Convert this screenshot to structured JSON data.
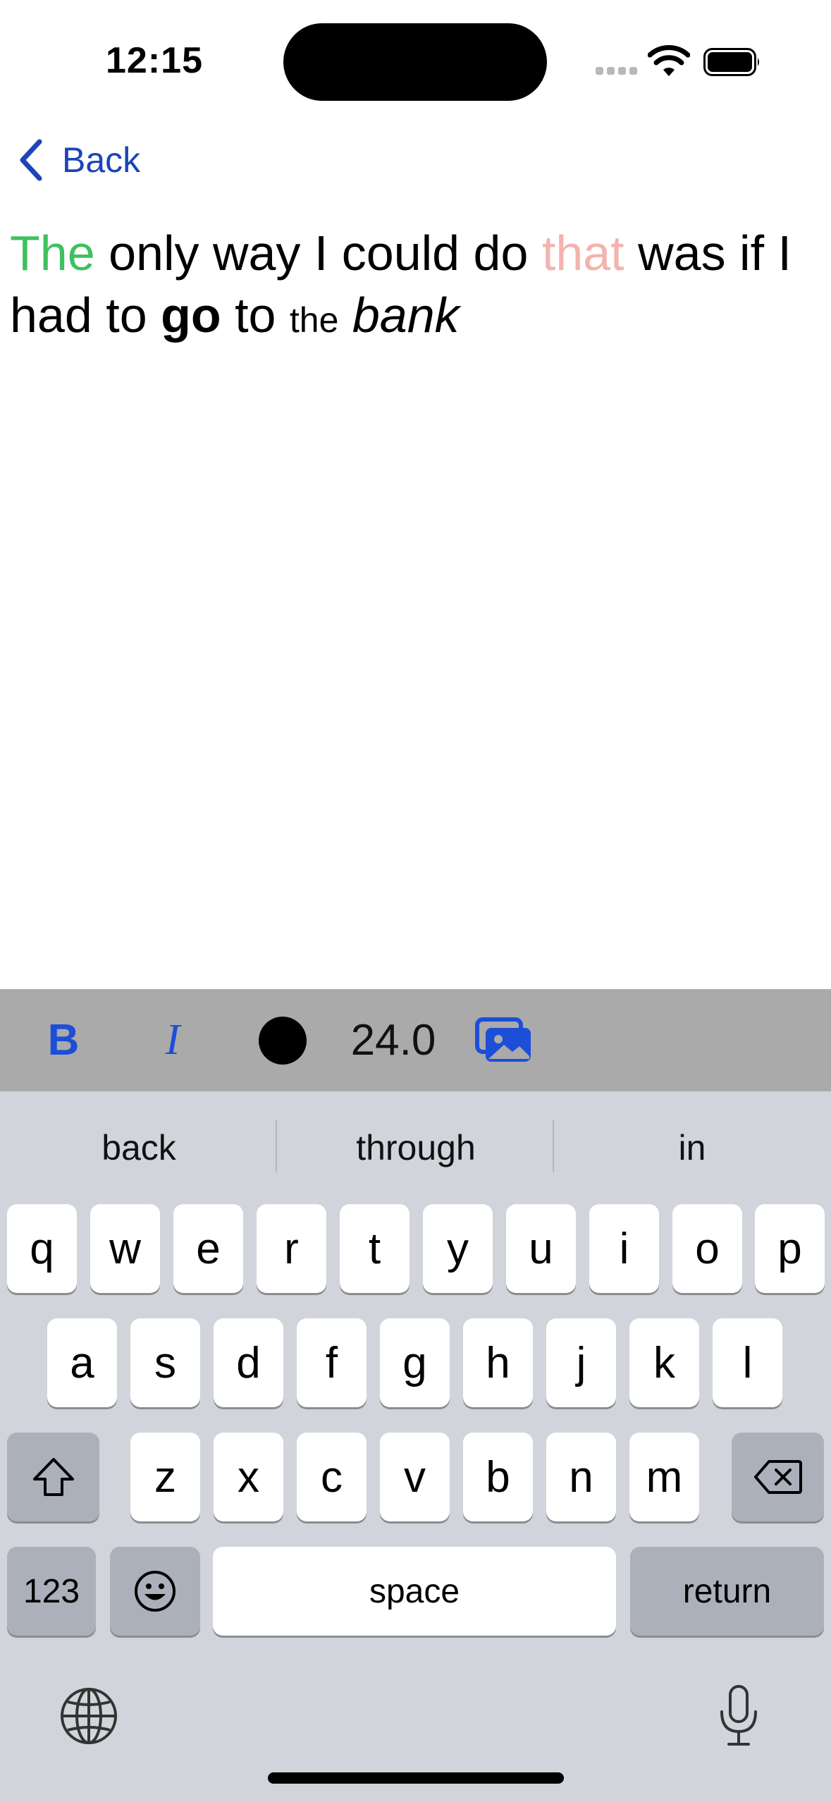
{
  "status_bar": {
    "time": "12:15"
  },
  "nav": {
    "back_label": "Back"
  },
  "editor": {
    "words": [
      {
        "text": "The",
        "style": "green",
        "color": "#3ec15e"
      },
      {
        "text": "only way I could do",
        "style": "normal"
      },
      {
        "text": "that",
        "style": "pink",
        "color": "#f3b3ae"
      },
      {
        "text": "was if I had to",
        "style": "normal"
      },
      {
        "text": "go",
        "style": "bold"
      },
      {
        "text": "to",
        "style": "normal"
      },
      {
        "text": "the",
        "style": "small"
      },
      {
        "text": "bank",
        "style": "italic"
      }
    ]
  },
  "toolbar": {
    "bold_label": "B",
    "italic_label": "I",
    "text_color": "#000000",
    "font_size": "24.0",
    "photo_icon": "photo-icon"
  },
  "keyboard": {
    "suggestions": [
      "back",
      "through",
      "in"
    ],
    "row1": [
      "q",
      "w",
      "e",
      "r",
      "t",
      "y",
      "u",
      "i",
      "o",
      "p"
    ],
    "row2": [
      "a",
      "s",
      "d",
      "f",
      "g",
      "h",
      "j",
      "k",
      "l"
    ],
    "row3": [
      "z",
      "x",
      "c",
      "v",
      "b",
      "n",
      "m"
    ],
    "numbers_label": "123",
    "space_label": "space",
    "return_label": "return",
    "icons": [
      "shift-icon",
      "delete-icon",
      "emoji-icon",
      "globe-icon",
      "microphone-icon"
    ]
  },
  "colors": {
    "accent": "#1d4ed8",
    "back_link": "#1d44b8",
    "toolbar_bg": "#aaaaaa",
    "keyboard_bg": "#d1d4da"
  }
}
